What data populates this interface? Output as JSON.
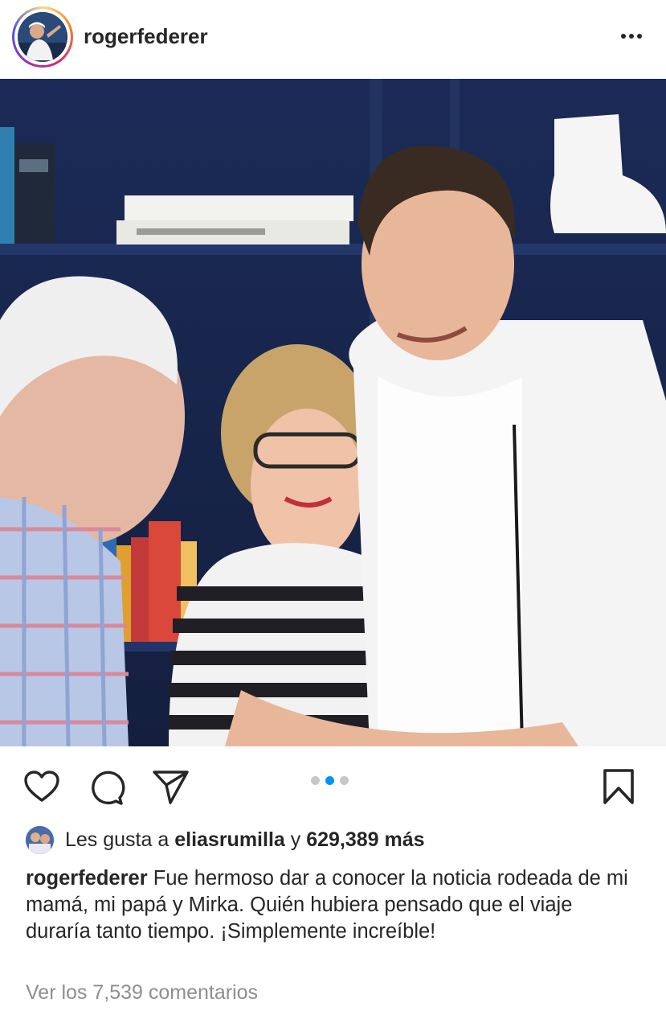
{
  "post": {
    "username": "rogerfederer",
    "likes_prefix": "Les gusta a ",
    "likes_user": "eliasrumilla",
    "likes_join": " y ",
    "likes_count": "629,389 más",
    "caption_username": "rogerfederer",
    "caption_text": " Fue hermoso dar a conocer la noticia rodeada de mi mamá, mi papá y Mirka. Quién hubiera pensado que el viaje duraría tanto tiempo. ¡Simplemente increíble!",
    "view_comments": "Ver los 7,539 comentarios",
    "carousel": {
      "total": 3,
      "active_index": 1
    }
  },
  "icons": {
    "more": "more-options-icon",
    "like": "heart-icon",
    "comment": "comment-bubble-icon",
    "share": "paper-plane-icon",
    "save": "bookmark-icon"
  },
  "colors": {
    "text": "#262626",
    "muted": "#8e8e8e",
    "accent": "#0095f6",
    "dot_inactive": "#c7c7c7"
  }
}
